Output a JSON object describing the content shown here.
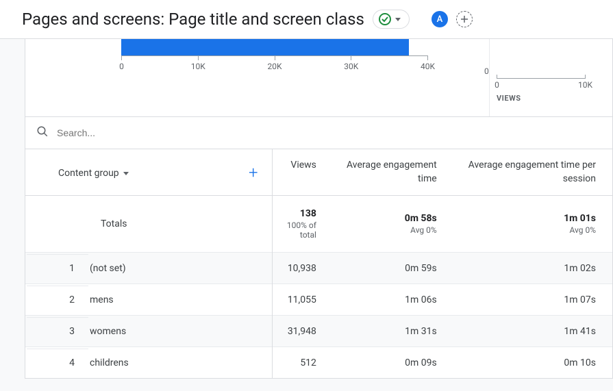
{
  "header": {
    "title": "Pages and screens: Page title and screen class",
    "avatar_letter": "A"
  },
  "chart_data": {
    "type": "bar",
    "orientation": "horizontal",
    "main_axis_ticks": [
      "0",
      "10K",
      "20K",
      "30K",
      "40K"
    ],
    "side_axis_ticks": [
      "0",
      "10K"
    ],
    "side_axis_zero": "0",
    "side_axis_title": "VIEWS"
  },
  "table": {
    "search_placeholder": "Search...",
    "dimension_label": "Content group",
    "columns": [
      "Views",
      "Average engagement time",
      "Average engagement time per session"
    ],
    "totals": {
      "label": "Totals",
      "values": [
        {
          "main": "138",
          "sub": "100% of total"
        },
        {
          "main": "0m 58s",
          "sub": "Avg 0%"
        },
        {
          "main": "1m 01s",
          "sub": "Avg 0%"
        }
      ]
    },
    "rows": [
      {
        "idx": "1",
        "name": "(not set)",
        "views": "10,938",
        "aet": "0m 59s",
        "aets": "1m 02s"
      },
      {
        "idx": "2",
        "name": "mens",
        "views": "11,055",
        "aet": "1m 06s",
        "aets": "1m 07s"
      },
      {
        "idx": "3",
        "name": "womens",
        "views": "31,948",
        "aet": "1m 31s",
        "aets": "1m 41s"
      },
      {
        "idx": "4",
        "name": "childrens",
        "views": "512",
        "aet": "0m 09s",
        "aets": "0m 10s"
      }
    ]
  }
}
